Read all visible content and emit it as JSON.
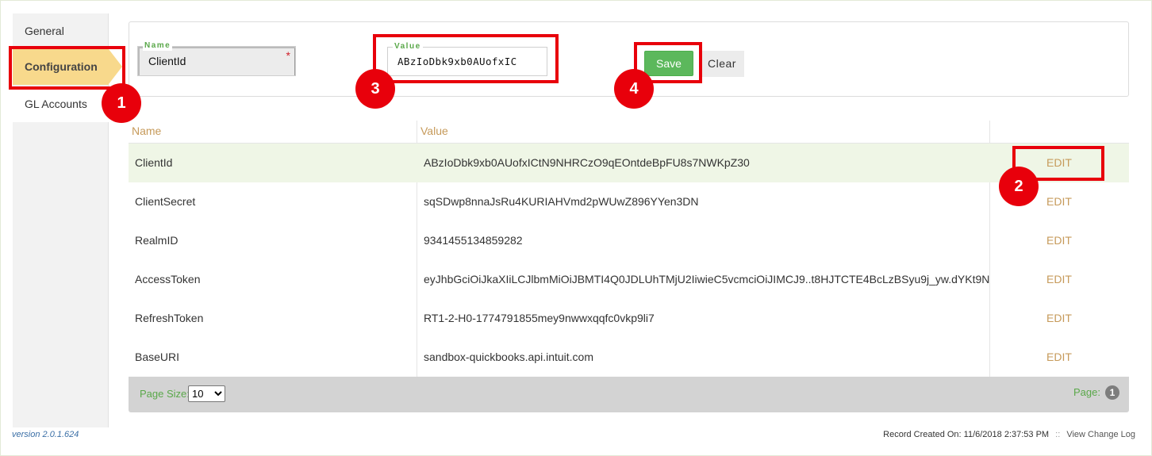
{
  "sidebar": {
    "items": [
      {
        "label": "General"
      },
      {
        "label": "Configuration"
      },
      {
        "label": "GL Accounts"
      }
    ]
  },
  "form": {
    "name_legend": "Name",
    "name_value": "ClientId",
    "required_mark": "*",
    "value_legend": "Value",
    "value_value": "ABzIoDbk9xb0AUofxIC",
    "save_label": "Save",
    "clear_label": "Clear"
  },
  "grid": {
    "headers": {
      "name": "Name",
      "value": "Value"
    },
    "rows": [
      {
        "name": "ClientId",
        "value": "ABzIoDbk9xb0AUofxICtN9NHRCzO9qEOntdeBpFU8s7NWKpZ30",
        "action": "EDIT"
      },
      {
        "name": "ClientSecret",
        "value": "sqSDwp8nnaJsRu4KURIAHVmd2pWUwZ896YYen3DN",
        "action": "EDIT"
      },
      {
        "name": "RealmID",
        "value": "9341455134859282",
        "action": "EDIT"
      },
      {
        "name": "AccessToken",
        "value": "eyJhbGciOiJkaXIiLCJlbmMiOiJBMTI4Q0JDLUhTMjU2IiwieC5vcmciOiJIMCJ9..t8HJTCTE4BcLzBSyu9j_yw.dYKt9N",
        "action": "EDIT"
      },
      {
        "name": "RefreshToken",
        "value": "RT1-2-H0-1774791855mey9nwwxqqfc0vkp9li7",
        "action": "EDIT"
      },
      {
        "name": "BaseURI",
        "value": "sandbox-quickbooks.api.intuit.com",
        "action": "EDIT"
      }
    ],
    "pager": {
      "page_size_label": "Page Size:",
      "page_size_value": "10",
      "page_size_options": [
        "10"
      ],
      "page_label": "Page:",
      "current_page": "1"
    }
  },
  "footer": {
    "version": "version 2.0.1.624",
    "record_created_label": "Record Created On:",
    "record_created_value": "11/6/2018 2:37:53 PM",
    "separator": "::",
    "change_log_link": "View Change Log"
  },
  "annotations": {
    "badges": [
      "1",
      "2",
      "3",
      "4"
    ],
    "color": "#e8000b"
  },
  "colors": {
    "accent_gold": "#c69a5a",
    "accent_green": "#5aa84a",
    "save_green": "#5cb85c",
    "active_nav": "#f8d98c",
    "selected_row": "#eff6e6"
  }
}
